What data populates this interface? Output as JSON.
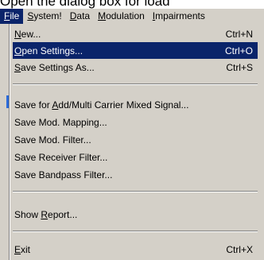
{
  "caption": "Open the dialog box for load",
  "menubar": {
    "items": [
      {
        "mnemonic": "F",
        "rest": "ile"
      },
      {
        "mnemonic": "S",
        "rest": "ystem!"
      },
      {
        "mnemonic": "D",
        "rest": "ata"
      },
      {
        "mnemonic": "M",
        "rest": "odulation"
      },
      {
        "mnemonic": "I",
        "rest": "mpairments"
      }
    ]
  },
  "file_menu": {
    "items": [
      {
        "pre": "",
        "mnemonic": "N",
        "post": "ew...",
        "shortcut": "Ctrl+N"
      },
      {
        "pre": "",
        "mnemonic": "O",
        "post": "pen Settings...",
        "shortcut": "Ctrl+O"
      },
      {
        "pre": "",
        "mnemonic": "S",
        "post": "ave Settings As...",
        "shortcut": "Ctrl+S"
      },
      {
        "pre": "Save for ",
        "mnemonic": "A",
        "post": "dd/Multi Carrier Mixed Signal...",
        "shortcut": ""
      },
      {
        "pre": "Save Mod. Mapping...",
        "mnemonic": "",
        "post": "",
        "shortcut": ""
      },
      {
        "pre": "Save Mod. Filter...",
        "mnemonic": "",
        "post": "",
        "shortcut": ""
      },
      {
        "pre": "Save Receiver Filter...",
        "mnemonic": "",
        "post": "",
        "shortcut": ""
      },
      {
        "pre": "Save Bandpass Filter...",
        "mnemonic": "",
        "post": "",
        "shortcut": ""
      },
      {
        "pre": "Show ",
        "mnemonic": "R",
        "post": "eport...",
        "shortcut": ""
      },
      {
        "pre": "",
        "mnemonic": "E",
        "post": "xit",
        "shortcut": "Ctrl+X"
      }
    ]
  },
  "colors": {
    "menu_background": "#d4d0c8",
    "highlight": "#0a246a",
    "highlight_text": "#ffffff"
  }
}
